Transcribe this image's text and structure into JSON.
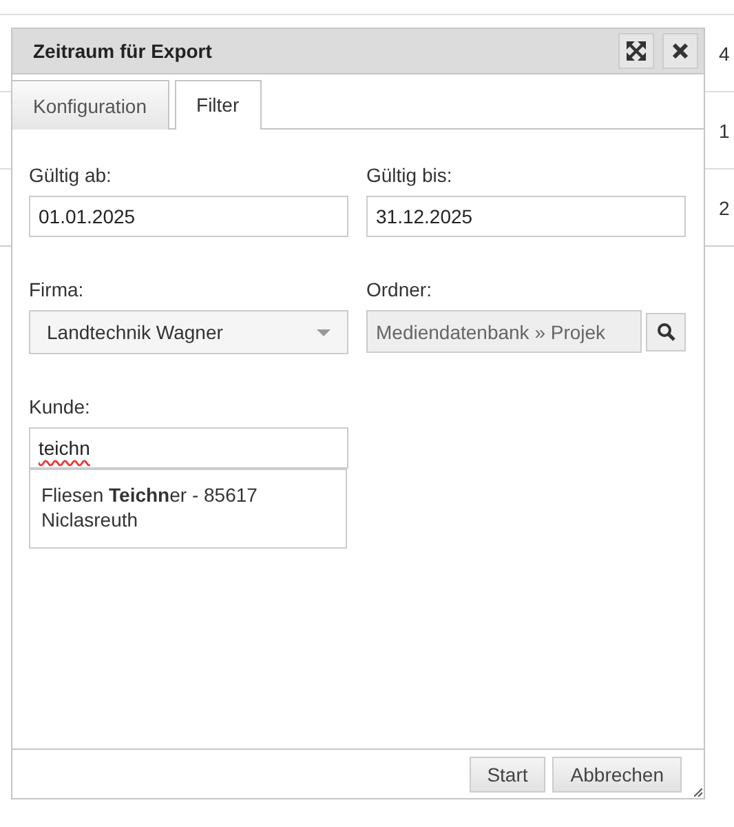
{
  "background": {
    "cells": [
      "4",
      "1",
      "2"
    ]
  },
  "dialog": {
    "title": "Zeitraum für Export",
    "tabs": [
      {
        "label": "Konfiguration",
        "selected": false
      },
      {
        "label": "Filter",
        "selected": true
      }
    ],
    "fields": [
      {
        "kind": "text",
        "label": "Gültig ab:",
        "value": "01.01.2025"
      },
      {
        "kind": "text",
        "label": "Gültig bis:",
        "value": "31.12.2025"
      },
      {
        "kind": "select",
        "label": "Firma:",
        "value": "Landtechnik Wagner"
      },
      {
        "kind": "picker",
        "label": "Ordner:",
        "value": "Mediendatenbank » Projek"
      },
      {
        "kind": "autocomplete",
        "label": "Kunde:",
        "value": "teichn",
        "suggestions": [
          "Fliesen **Teichn**er - 85617 Niclasreuth"
        ]
      }
    ],
    "buttons": [
      "Start",
      "Abbrechen"
    ]
  }
}
